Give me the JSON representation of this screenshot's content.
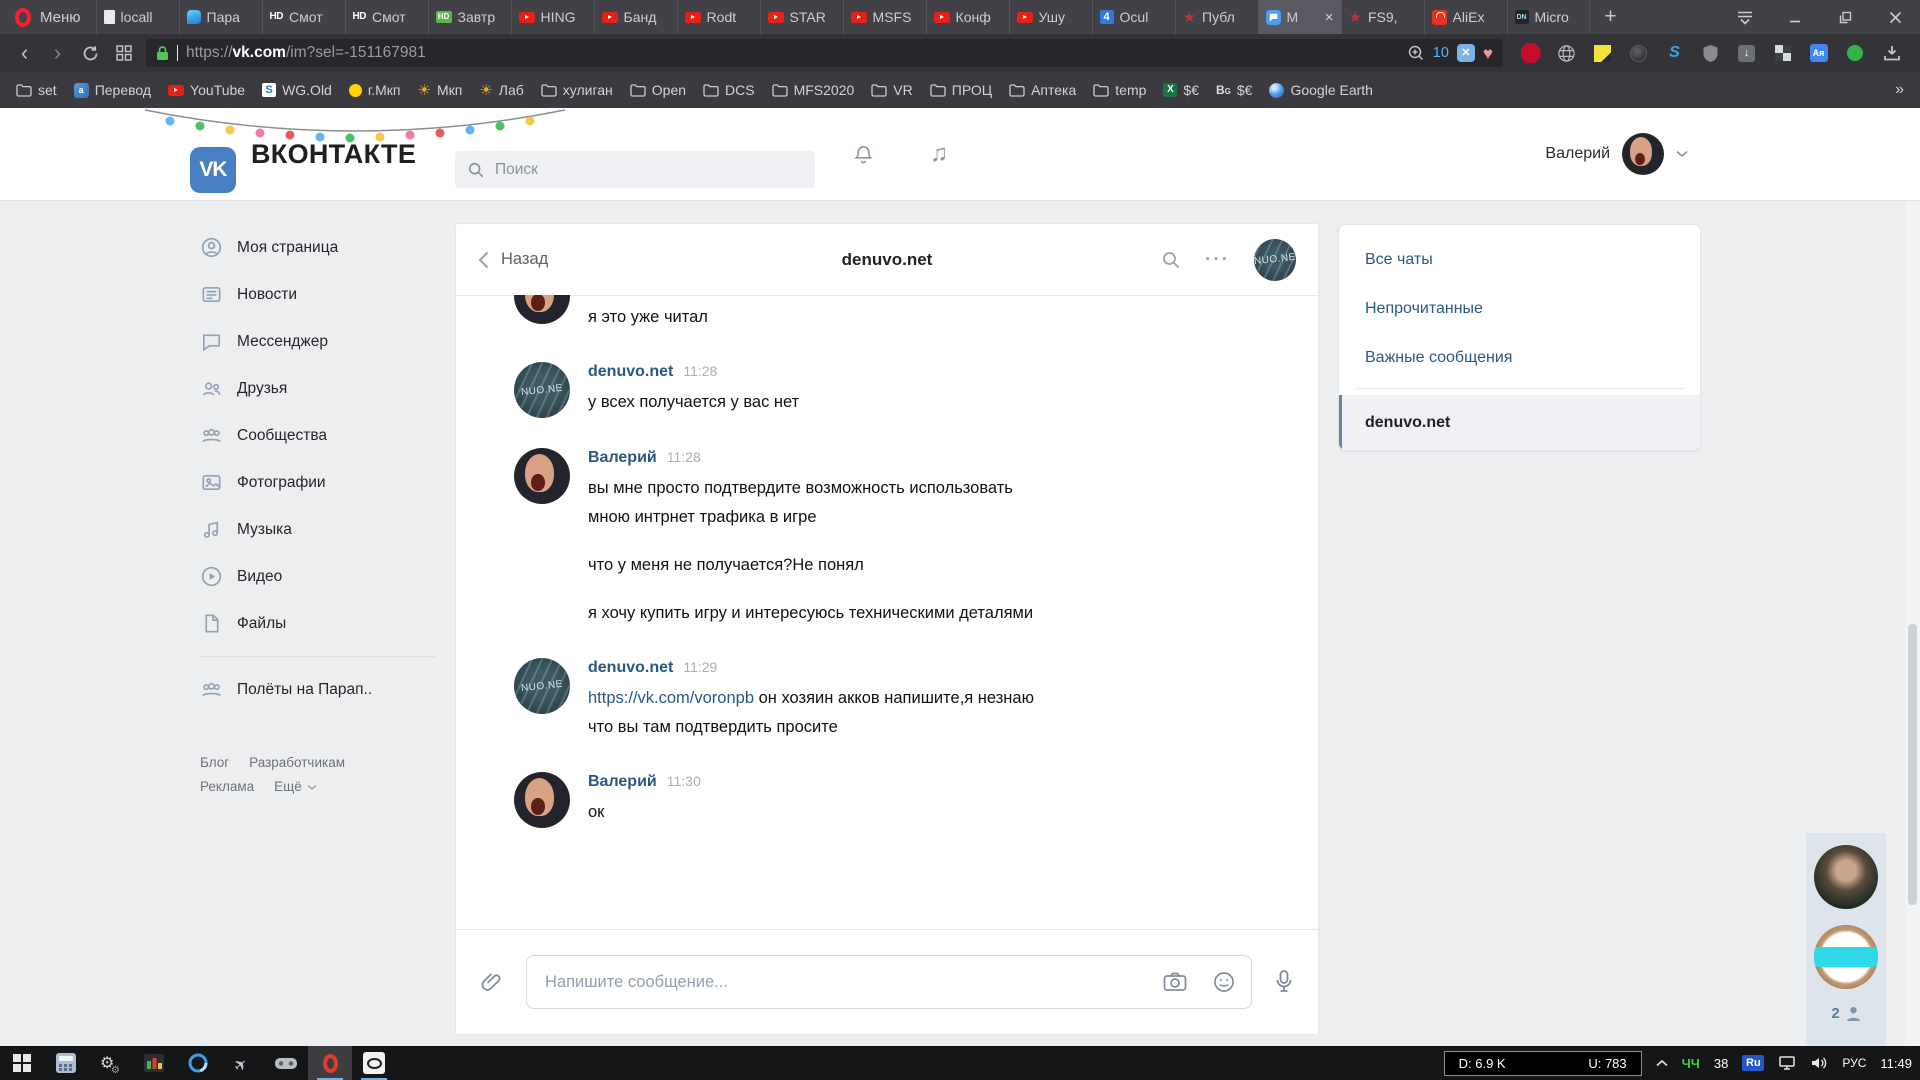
{
  "browser": {
    "menu_label": "Меню",
    "tabs": [
      {
        "title": "locall",
        "icon": "doc"
      },
      {
        "title": "Пара",
        "icon": "chatblue"
      },
      {
        "title": "Смот",
        "icon": "hd"
      },
      {
        "title": "Смот",
        "icon": "hd"
      },
      {
        "title": "Завтр",
        "icon": "hdgreen"
      },
      {
        "title": "HING",
        "icon": "youtube"
      },
      {
        "title": "Банд",
        "icon": "youtube"
      },
      {
        "title": "Rodt",
        "icon": "youtube"
      },
      {
        "title": "STAR",
        "icon": "youtube"
      },
      {
        "title": "MSFS",
        "icon": "youtube"
      },
      {
        "title": "Конф",
        "icon": "youtube"
      },
      {
        "title": "Ушу",
        "icon": "youtube"
      },
      {
        "title": "Ocul",
        "icon": "fourpda"
      },
      {
        "title": "Публ",
        "icon": "redstar"
      },
      {
        "title": "M",
        "icon": "messenger",
        "active": true
      },
      {
        "title": "FS9,",
        "icon": "redstar"
      },
      {
        "title": "AliEx",
        "icon": "aliexpress"
      },
      {
        "title": "Micro",
        "icon": "dn"
      }
    ],
    "new_tab_label": "+",
    "url": {
      "scheme": "https://",
      "domain": "vk.com",
      "path": "/im?sel=-151167981"
    },
    "zoom_badge": "10",
    "extensions": [
      "adblock-plus",
      "globe",
      "sticky-notes",
      "dark-disc",
      "s-logo",
      "shield",
      "down-arrow",
      "checkerboard",
      "page-translator",
      "green-dot"
    ],
    "bookmarks": [
      {
        "label": "set",
        "icon": "folder"
      },
      {
        "label": "Перевод",
        "icon": "translate"
      },
      {
        "label": "YouTube",
        "icon": "youtube"
      },
      {
        "label": "WG.Old",
        "icon": "wg"
      },
      {
        "label": "г.Мкп",
        "icon": "dot-yellow"
      },
      {
        "label": "Мкп",
        "icon": "sun"
      },
      {
        "label": "Лаб",
        "icon": "sun"
      },
      {
        "label": "хулиган",
        "icon": "folder"
      },
      {
        "label": "Open",
        "icon": "folder"
      },
      {
        "label": "DCS",
        "icon": "folder"
      },
      {
        "label": "MFS2020",
        "icon": "folder"
      },
      {
        "label": "VR",
        "icon": "folder"
      },
      {
        "label": "ПРОЦ",
        "icon": "folder"
      },
      {
        "label": "Аптека",
        "icon": "folder"
      },
      {
        "label": "temp",
        "icon": "folder"
      },
      {
        "label": "$€",
        "icon": "excel"
      },
      {
        "label": "$€",
        "icon": "bg"
      },
      {
        "label": "Google Earth",
        "icon": "earth"
      }
    ],
    "bookmarks_overflow": "»"
  },
  "vk": {
    "wordmark": "ВКОНТАКТЕ",
    "search_placeholder": "Поиск",
    "user_name": "Валерий",
    "sidebar": [
      {
        "label": "Моя страница",
        "icon": "profile"
      },
      {
        "label": "Новости",
        "icon": "news"
      },
      {
        "label": "Мессенджер",
        "icon": "messenger-bubble"
      },
      {
        "label": "Друзья",
        "icon": "friends"
      },
      {
        "label": "Сообщества",
        "icon": "groups"
      },
      {
        "label": "Фотографии",
        "icon": "photos"
      },
      {
        "label": "Музыка",
        "icon": "music-note"
      },
      {
        "label": "Видео",
        "icon": "video-play"
      },
      {
        "label": "Файлы",
        "icon": "files"
      },
      {
        "label": "Полёты на Парап..",
        "icon": "groups"
      }
    ],
    "footer_links": [
      "Блог",
      "Разработчикам",
      "Реклама",
      "Ещё"
    ],
    "chat": {
      "back_label": "Назад",
      "title": "denuvo.net",
      "denuvo_avatar_text": "NUO.NE",
      "messages": [
        {
          "partial": true,
          "avatar": "valeriy",
          "paragraphs": [
            [
              "я это уже читал"
            ]
          ]
        },
        {
          "author": "denuvo.net",
          "avatar": "denuvo",
          "time": "11:28",
          "paragraphs": [
            [
              "у всех получается у вас нет"
            ]
          ]
        },
        {
          "author": "Валерий",
          "avatar": "valeriy",
          "time": "11:28",
          "paragraphs": [
            [
              "вы мне просто подтвердите возможность использовать",
              "мною интрнет трафика в игре"
            ],
            [
              "что у меня не получается?Не понял"
            ],
            [
              "я хочу купить игру и интересуюсь техническими деталями"
            ]
          ]
        },
        {
          "author": "denuvo.net",
          "avatar": "denuvo",
          "time": "11:29",
          "paragraphs": [
            [
              {
                "link": "https://vk.com/voronpb",
                "text": " он хозяин акков напишите,я незнаю"
              },
              "что вы там подтвердить просите"
            ]
          ]
        },
        {
          "author": "Валерий",
          "avatar": "valeriy",
          "time": "11:30",
          "paragraphs": [
            [
              "ок"
            ]
          ]
        }
      ],
      "input_placeholder": "Напишите сообщение..."
    },
    "chat_list": {
      "filters": [
        "Все чаты",
        "Непрочитанные",
        "Важные сообщения"
      ],
      "active": "denuvo.net"
    }
  },
  "overlay": {
    "count": "2"
  },
  "taskbar": {
    "apps": [
      {
        "icon": "start"
      },
      {
        "icon": "calculator"
      },
      {
        "icon": "settings-gears"
      },
      {
        "icon": "activity-monitor"
      },
      {
        "icon": "blue-ring"
      },
      {
        "icon": "jet"
      },
      {
        "icon": "gamepad"
      },
      {
        "icon": "opera-app",
        "active": true,
        "running": true
      },
      {
        "icon": "camera-app",
        "running": true
      }
    ],
    "download": "D: 6.9 K",
    "upload": "U: 783",
    "tray_app": "ЧЧ",
    "tray_value": "38",
    "lang_badge": "Ru",
    "lang": "РУС",
    "time": "11:49"
  }
}
